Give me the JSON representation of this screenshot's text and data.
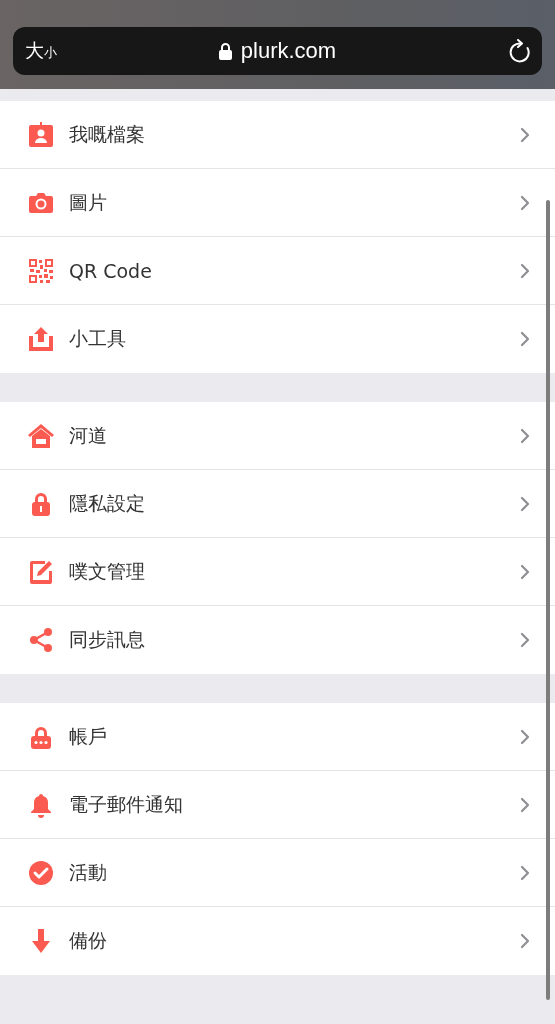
{
  "browser_bar": {
    "text_size_large": "大",
    "text_size_small": "小",
    "url": "plurk.com"
  },
  "sections": [
    {
      "items": [
        {
          "label": "我嘅檔案",
          "kind": "profile"
        },
        {
          "label": "圖片",
          "kind": "camera"
        },
        {
          "label": "QR Code",
          "kind": "qr"
        },
        {
          "label": "小工具",
          "kind": "upload"
        }
      ]
    },
    {
      "items": [
        {
          "label": "河道",
          "kind": "home"
        },
        {
          "label": "隱私設定",
          "kind": "lock"
        },
        {
          "label": "噗文管理",
          "kind": "edit"
        },
        {
          "label": "同步訊息",
          "kind": "share"
        }
      ]
    },
    {
      "items": [
        {
          "label": "帳戶",
          "kind": "account"
        },
        {
          "label": "電子郵件通知",
          "kind": "bell"
        },
        {
          "label": "活動",
          "kind": "check"
        },
        {
          "label": "備份",
          "kind": "download"
        }
      ]
    }
  ]
}
